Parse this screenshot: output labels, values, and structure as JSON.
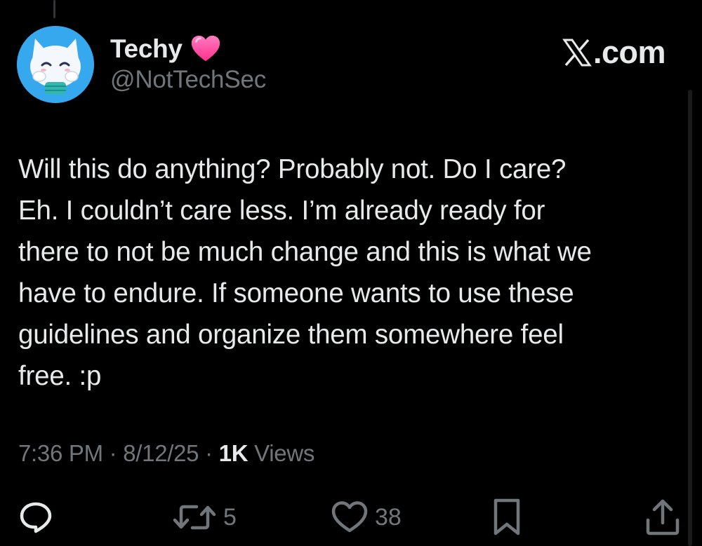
{
  "author": {
    "display_name": "Techy",
    "name_emoji_icon": "pink-heart-icon",
    "handle": "@NotTechSec",
    "avatar_icon": "cat-character-avatar"
  },
  "brand": {
    "logo_icon": "x-logo-icon",
    "text": ".com"
  },
  "tweet": {
    "text": "Will this do anything? Probably not. Do I care?\nEh. I couldn’t care less. I’m already ready for\nthere to not be much change and this is what we\nhave to endure. If someone wants to use these\nguidelines and organize them somewhere feel\nfree. :p"
  },
  "meta": {
    "time": "7:36 PM",
    "separator": " · ",
    "date": "8/12/25",
    "views_count": "1K",
    "views_label": " Views"
  },
  "actions": {
    "reply_icon": "reply-icon",
    "retweet_icon": "retweet-icon",
    "retweet_count": "5",
    "like_icon": "heart-outline-icon",
    "like_count": "38",
    "bookmark_icon": "bookmark-icon",
    "share_icon": "share-icon"
  },
  "colors": {
    "background": "#000000",
    "primary_text": "#e7e9ea",
    "secondary_text": "#71767b",
    "heart": "#ff4fa3"
  }
}
